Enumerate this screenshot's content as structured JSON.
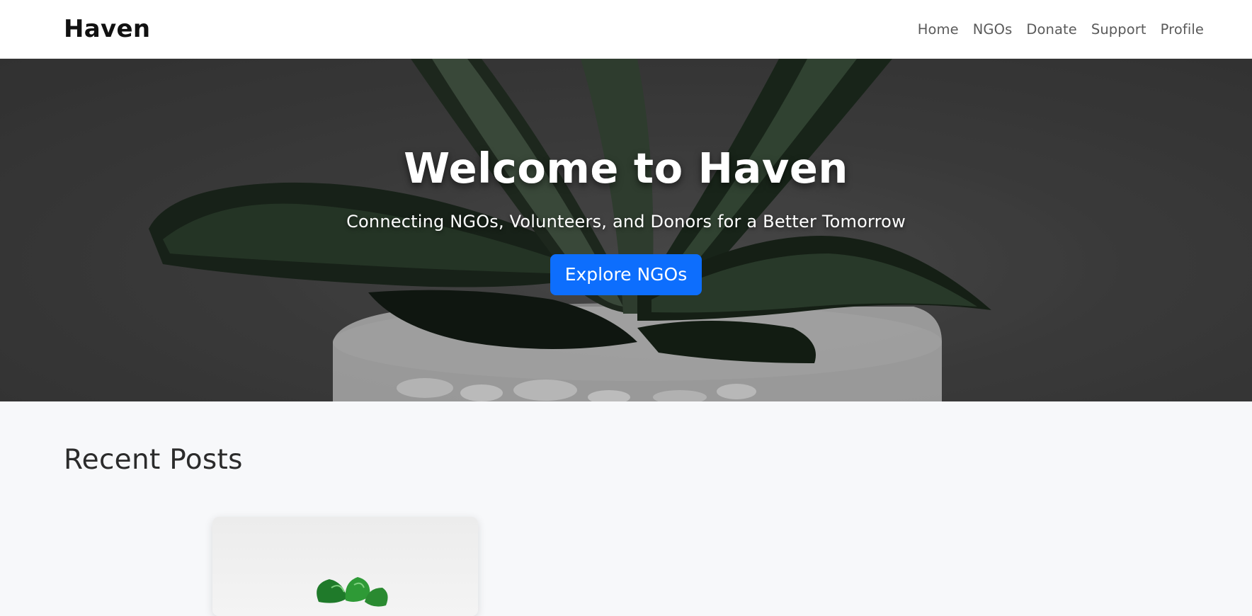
{
  "navbar": {
    "brand": "Haven",
    "links": [
      {
        "label": "Home"
      },
      {
        "label": "NGOs"
      },
      {
        "label": "Donate"
      },
      {
        "label": "Support"
      },
      {
        "label": "Profile"
      }
    ]
  },
  "hero": {
    "title": "Welcome to Haven",
    "subtitle": "Connecting NGOs, Volunteers, and Donors for a Better Tomorrow",
    "button_label": "Explore NGOs",
    "accent_color": "#0d6efd",
    "background_icon": "plant-photo"
  },
  "recent_posts": {
    "title": "Recent Posts",
    "cards": [
      {
        "image_icon": "plant-sprout-photo"
      }
    ]
  }
}
